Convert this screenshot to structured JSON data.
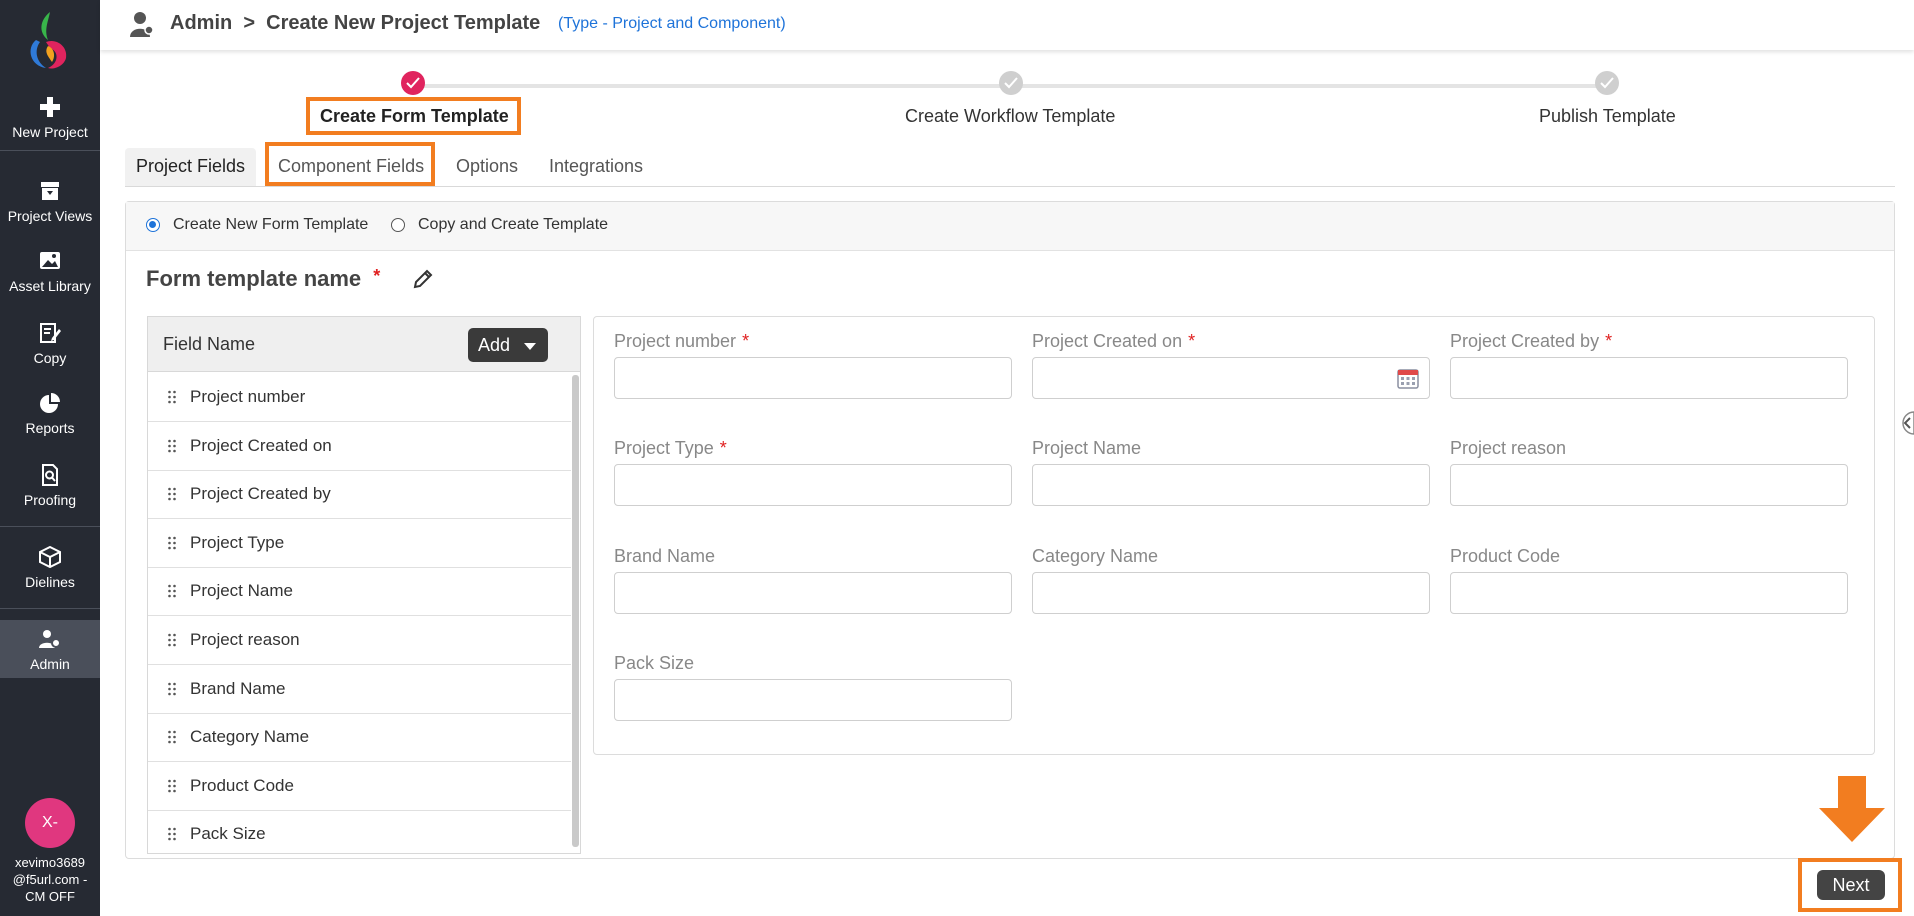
{
  "sidebar": {
    "logo_name": "app-logo",
    "items": [
      {
        "label": "New Project",
        "icon": "plus-icon"
      },
      {
        "label": "Project Views",
        "icon": "archive-icon"
      },
      {
        "label": "Asset Library",
        "icon": "image-icon"
      },
      {
        "label": "Copy",
        "icon": "edit-document-icon"
      },
      {
        "label": "Reports",
        "icon": "pie-chart-icon"
      },
      {
        "label": "Proofing",
        "icon": "search-document-icon"
      },
      {
        "label": "Dielines",
        "icon": "cube-icon"
      },
      {
        "label": "Admin",
        "icon": "user-gear-icon"
      }
    ],
    "user": {
      "avatar_text": "X-",
      "line1": "xevimo3689",
      "line2": "@f5url.com -",
      "line3": "CM OFF"
    }
  },
  "header": {
    "title": "Admin  >  Create New Project Template",
    "type_text": "(Type - Project and Component)"
  },
  "stepper": {
    "steps": [
      {
        "label": "Create Form Template",
        "status": "done"
      },
      {
        "label": "Create Workflow Template",
        "status": "pending"
      },
      {
        "label": "Publish Template",
        "status": "pending"
      }
    ]
  },
  "tabs": [
    "Project Fields",
    "Component Fields",
    "Options",
    "Integrations"
  ],
  "radio_options": {
    "create_new": "Create New Form Template",
    "copy_create": "Copy and Create Template",
    "selected": "create_new"
  },
  "form_name": {
    "label": "Form template name",
    "required": "*"
  },
  "field_list": {
    "header": "Field Name",
    "add_label": "Add",
    "items": [
      "Project number",
      "Project Created on",
      "Project Created by",
      "Project Type",
      "Project Name",
      "Project reason",
      "Brand Name",
      "Category Name",
      "Product Code",
      "Pack Size"
    ]
  },
  "preview_fields": [
    {
      "label": "Project number",
      "required": "*"
    },
    {
      "label": "Project Created on",
      "required": "*"
    },
    {
      "label": "Project Created by",
      "required": "*"
    },
    {
      "label": "Project Type",
      "required": "*"
    },
    {
      "label": "Project Name",
      "required": ""
    },
    {
      "label": "Project reason",
      "required": ""
    },
    {
      "label": "Brand Name",
      "required": ""
    },
    {
      "label": "Category Name",
      "required": ""
    },
    {
      "label": "Product Code",
      "required": ""
    },
    {
      "label": "Pack Size",
      "required": ""
    }
  ],
  "footer": {
    "next_label": "Next"
  },
  "colors": {
    "sidebar_bg": "#262a33",
    "accent_orange": "#f27d20",
    "step_done": "#e0245e",
    "link_blue": "#1e73d9"
  }
}
